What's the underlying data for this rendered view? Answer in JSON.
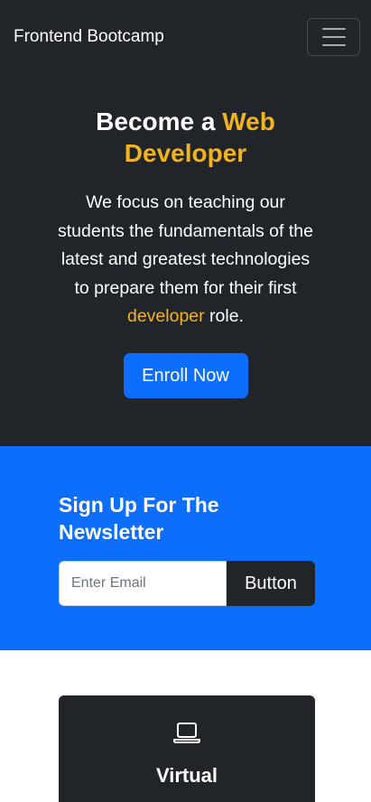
{
  "navbar": {
    "brand": "Frontend Bootcamp",
    "toggler_icon": "hamburger-menu-icon"
  },
  "hero": {
    "title_prefix": "Become a ",
    "title_accent": "Web Developer",
    "description_prefix": "We focus on teaching our students the fundamentals of the latest and greatest technologies to prepare them for their first ",
    "description_accent": "developer",
    "description_suffix": " role.",
    "cta_label": "Enroll Now"
  },
  "newsletter": {
    "title": "Sign Up For The Newsletter",
    "email_placeholder": "Enter Email",
    "button_label": "Button"
  },
  "features": {
    "cards": [
      {
        "icon": "laptop-icon",
        "title": "Virtual"
      }
    ]
  },
  "colors": {
    "dark": "#212529",
    "primary": "#0d6efd",
    "accent": "#f0b322"
  }
}
